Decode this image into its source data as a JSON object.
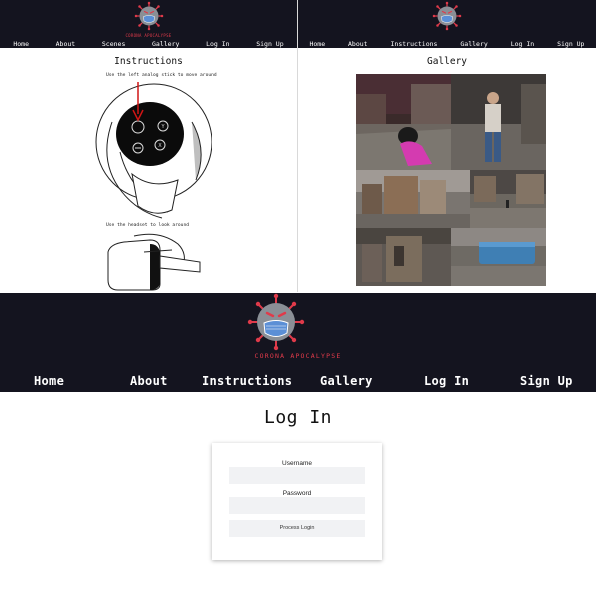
{
  "site": {
    "brand": "CORONA APOCALYPSE",
    "accent_color": "#e03a4a",
    "header_color": "#14141f"
  },
  "nav": {
    "items": [
      "Home",
      "About",
      "Scenes",
      "Gallery",
      "Log In",
      "Sign Up"
    ],
    "items_alt": [
      "Home",
      "About",
      "Instructions",
      "Gallery",
      "Log In",
      "Sign Up"
    ]
  },
  "instructions": {
    "title": "Instructions",
    "caption_analog": "Use the left analog stick to move around",
    "caption_headset": "Use the headset to look around",
    "controller_buttons": [
      "Y",
      "X"
    ]
  },
  "gallery": {
    "title": "Gallery"
  },
  "login": {
    "title": "Log In",
    "username_label": "Username",
    "username_value": "",
    "password_label": "Password",
    "password_value": "",
    "submit_label": "Process Login"
  },
  "icons": {
    "logo": "corona-virus-masked-face-icon",
    "controller": "vr-controller-icon",
    "headset": "vr-headset-icon",
    "arrow": "red-arrow-icon"
  }
}
